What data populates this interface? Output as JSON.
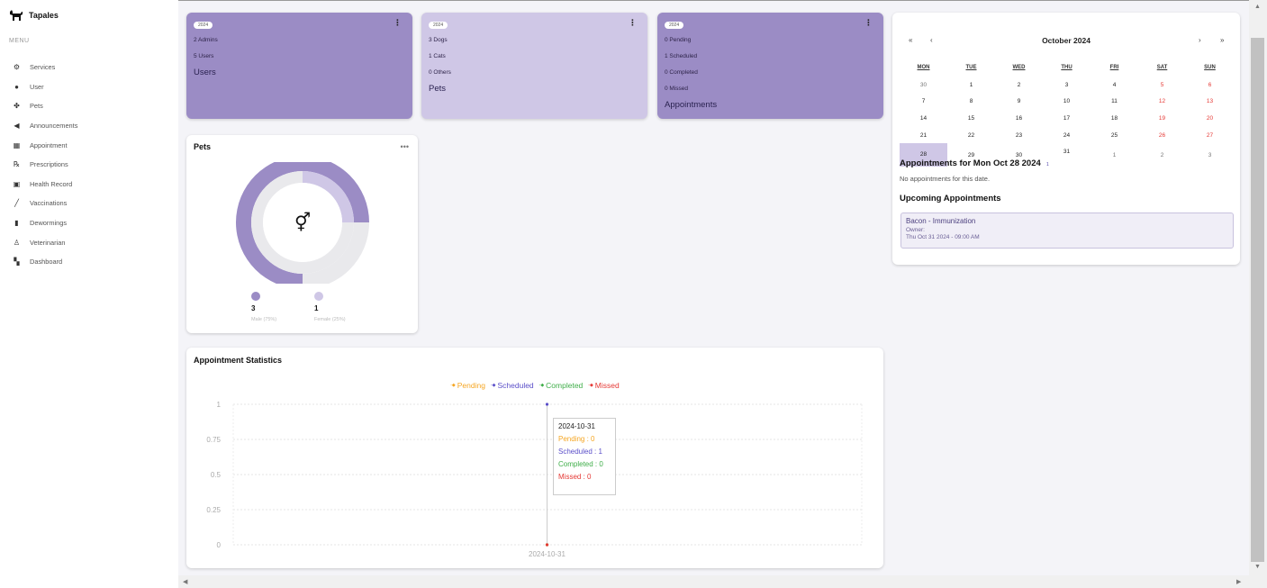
{
  "app": {
    "name": "Tapales",
    "menu_label": "MENU"
  },
  "sidebar": {
    "items": [
      {
        "label": "Services",
        "icon": "gear-icon"
      },
      {
        "label": "User",
        "icon": "user-icon"
      },
      {
        "label": "Pets",
        "icon": "paw-icon"
      },
      {
        "label": "Announcements",
        "icon": "megaphone-icon"
      },
      {
        "label": "Appointment",
        "icon": "calendar-icon"
      },
      {
        "label": "Prescriptions",
        "icon": "prescription-icon"
      },
      {
        "label": "Health Record",
        "icon": "medical-bag-icon"
      },
      {
        "label": "Vaccinations",
        "icon": "syringe-icon"
      },
      {
        "label": "Dewormings",
        "icon": "bottle-icon"
      },
      {
        "label": "Veterinarian",
        "icon": "doctor-icon"
      },
      {
        "label": "Dashboard",
        "icon": "dashboard-icon"
      }
    ]
  },
  "stats": {
    "users": {
      "badge": "2024",
      "lines": [
        "2 Admins",
        "5 Users"
      ],
      "title": "Users"
    },
    "pets": {
      "badge": "2024",
      "lines": [
        "3 Dogs",
        "1 Cats",
        "0 Others"
      ],
      "title": "Pets"
    },
    "appointments": {
      "badge": "2024",
      "lines": [
        "0 Pending",
        "1 Scheduled",
        "0 Completed",
        "0 Missed"
      ],
      "title": "Appointments"
    }
  },
  "pets_chart": {
    "title": "Pets",
    "center_icon": "gender-symbol-icon",
    "male": {
      "count": "3",
      "label": "Male (75%)",
      "fraction": 0.75
    },
    "female": {
      "count": "1",
      "label": "Female (25%)",
      "fraction": 0.25
    },
    "colors": {
      "male": "#9b8cc5",
      "female": "#cfc7e6",
      "track": "#e9e9ec"
    }
  },
  "calendar": {
    "month_label": "October 2024",
    "nav": {
      "prev_year": "«",
      "prev_month": "‹",
      "next_month": "›",
      "next_year": "»"
    },
    "weekdays": [
      "MON",
      "TUE",
      "WED",
      "THU",
      "FRI",
      "SAT",
      "SUN"
    ],
    "weeks": [
      [
        "30",
        "1",
        "2",
        "3",
        "4",
        "5",
        "6"
      ],
      [
        "7",
        "8",
        "9",
        "10",
        "11",
        "12",
        "13"
      ],
      [
        "14",
        "15",
        "16",
        "17",
        "18",
        "19",
        "20"
      ],
      [
        "21",
        "22",
        "23",
        "24",
        "25",
        "26",
        "27"
      ],
      [
        "28",
        "29",
        "30",
        "31",
        "1",
        "2",
        "3"
      ]
    ],
    "selected_day": "28",
    "appointment_marker": "1"
  },
  "appointments_panel": {
    "date_title": "Appointments for Mon Oct 28 2024",
    "empty_text": "No appointments for this date.",
    "upcoming_title": "Upcoming Appointments",
    "upcoming": [
      {
        "title": "Bacon - Immunization",
        "owner": "Owner:",
        "when": "Thu Oct 31 2024 - 09:00 AM"
      }
    ]
  },
  "chart_data": {
    "type": "line",
    "title": "Appointment Statistics",
    "x": [
      "2024-10-31"
    ],
    "series": [
      {
        "name": "Pending",
        "values": [
          0
        ],
        "color": "#f5a623"
      },
      {
        "name": "Scheduled",
        "values": [
          1
        ],
        "color": "#5b4fc9"
      },
      {
        "name": "Completed",
        "values": [
          0
        ],
        "color": "#3fae49"
      },
      {
        "name": "Missed",
        "values": [
          0
        ],
        "color": "#e53935"
      }
    ],
    "ylim": [
      0,
      1
    ],
    "yticks": [
      "1",
      "0.75",
      "0.5",
      "0.25",
      "0"
    ],
    "grid": true,
    "legend_position": "top-center",
    "tooltip": {
      "date": "2024-10-31",
      "rows": [
        "Pending : 0",
        "Scheduled : 1",
        "Completed : 0",
        "Missed : 0"
      ]
    }
  }
}
